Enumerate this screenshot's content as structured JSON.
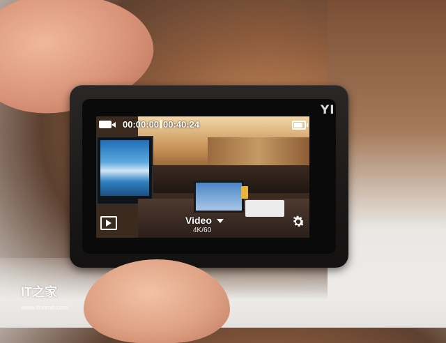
{
  "camera": {
    "brand_logo": "YI"
  },
  "screen": {
    "elapsed_time": "00:00:00",
    "remaining_time": "00:40:24",
    "mode_label": "Video",
    "mode_detail": "4K/60",
    "battery_level": 0.85,
    "icons": [
      "video-camera-icon",
      "battery-icon",
      "playback-icon",
      "chevron-down-icon",
      "settings-gear-icon"
    ]
  },
  "watermark": {
    "logo_text": "IT之家",
    "url": "www.ithome.com"
  },
  "colors": {
    "hud_text": "#ffffff",
    "camera_body": "#1b1918"
  }
}
